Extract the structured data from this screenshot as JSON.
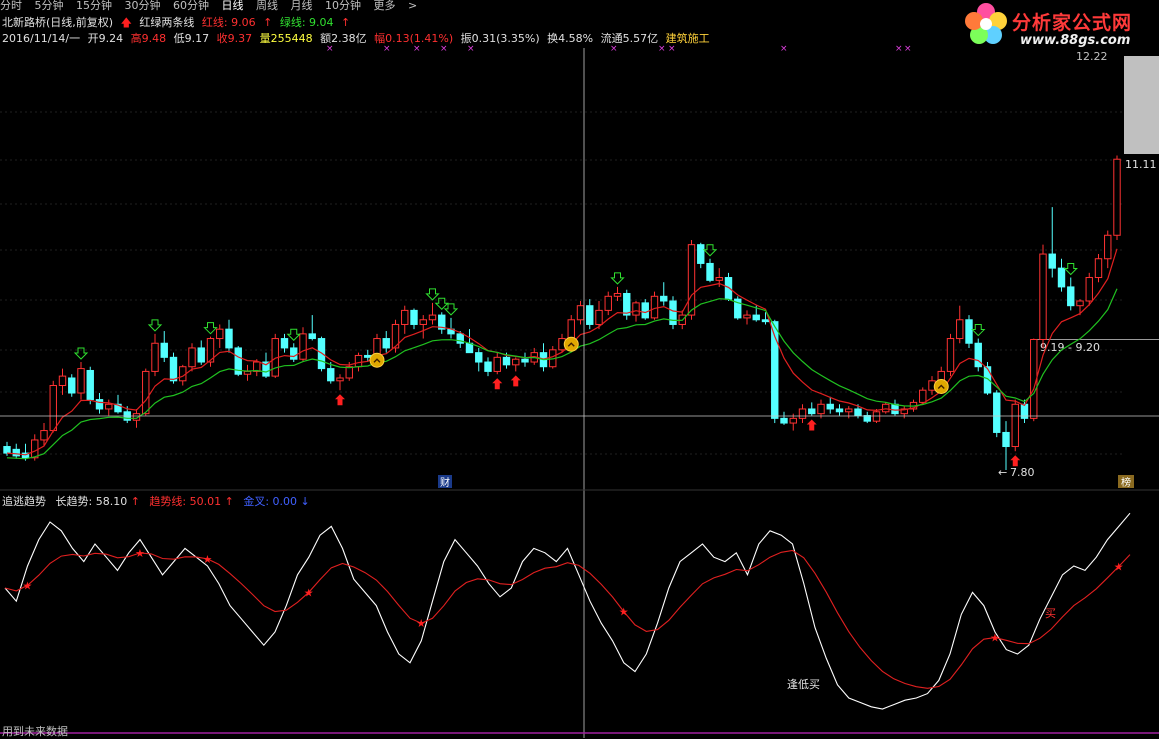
{
  "toolbar": {
    "items": [
      "分时",
      "5分钟",
      "15分钟",
      "30分钟",
      "60分钟",
      "日线",
      "周线",
      "月线",
      "10分钟",
      "更多",
      ">"
    ],
    "active": "日线"
  },
  "logo": {
    "title": "分析家公式网",
    "url": "www.88gs.com"
  },
  "header": {
    "stock": "北新路桥(日线,前复权)",
    "indicator": "红绿两条线",
    "red_label": "红线: 9.06",
    "green_label": "绿线: 9.04",
    "date": "2016/11/14/一",
    "open": "开9.24",
    "high": "高9.48",
    "low": "低9.17",
    "close": "收9.37",
    "volume": "量255448",
    "amount": "额2.38亿",
    "change": "幅0.13(1.41%)",
    "amplitude": "振0.31(3.35%)",
    "turnover": "换4.58%",
    "float": "流通5.57亿",
    "sector": "建筑施工"
  },
  "price_labels": {
    "top": "12.22",
    "high": "11.11",
    "range": "9.19 - 9.20",
    "low": "7.80"
  },
  "markers": {
    "cai": "财",
    "bang": "榜"
  },
  "lower": {
    "name": "追逃趋势",
    "long_trend": "长趋势: 58.10",
    "trend_line": "趋势线: 50.01",
    "golden": "金叉: 0.00",
    "low_buy_label": "逢低买",
    "buy_label": "买"
  },
  "footer": {
    "note": "用到未来数据"
  },
  "colors": {
    "up": "#ff3232",
    "down": "#54ffff",
    "red_ma": "#e02020",
    "green_ma": "#20c020",
    "cross": "#c8c8c8"
  },
  "chart_data": {
    "type": "candlestick",
    "candles": [
      [
        8.05,
        8.1,
        7.95,
        7.98
      ],
      [
        8.02,
        8.08,
        7.92,
        7.95
      ],
      [
        7.98,
        8.08,
        7.9,
        7.93
      ],
      [
        7.93,
        8.18,
        7.9,
        8.12
      ],
      [
        8.12,
        8.3,
        8.05,
        8.22
      ],
      [
        8.22,
        8.75,
        8.2,
        8.7
      ],
      [
        8.7,
        8.88,
        8.6,
        8.8
      ],
      [
        8.78,
        8.82,
        8.58,
        8.62
      ],
      [
        8.62,
        8.95,
        8.55,
        8.88
      ],
      [
        8.86,
        8.9,
        8.5,
        8.55
      ],
      [
        8.55,
        8.62,
        8.4,
        8.45
      ],
      [
        8.45,
        8.55,
        8.38,
        8.5
      ],
      [
        8.5,
        8.6,
        8.4,
        8.42
      ],
      [
        8.42,
        8.48,
        8.3,
        8.33
      ],
      [
        8.33,
        8.45,
        8.25,
        8.4
      ],
      [
        8.4,
        8.88,
        8.38,
        8.85
      ],
      [
        8.85,
        9.25,
        8.8,
        9.15
      ],
      [
        9.15,
        9.28,
        8.95,
        9.0
      ],
      [
        9.0,
        9.05,
        8.72,
        8.75
      ],
      [
        8.75,
        8.92,
        8.7,
        8.9
      ],
      [
        8.9,
        9.15,
        8.85,
        9.1
      ],
      [
        9.1,
        9.18,
        8.92,
        8.95
      ],
      [
        8.95,
        9.22,
        8.9,
        9.2
      ],
      [
        9.2,
        9.35,
        9.1,
        9.3
      ],
      [
        9.3,
        9.4,
        9.05,
        9.1
      ],
      [
        9.1,
        9.12,
        8.8,
        8.82
      ],
      [
        8.82,
        8.92,
        8.75,
        8.85
      ],
      [
        8.85,
        8.98,
        8.8,
        8.95
      ],
      [
        8.95,
        9.05,
        8.78,
        8.8
      ],
      [
        8.8,
        9.25,
        8.78,
        9.2
      ],
      [
        9.2,
        9.25,
        9.05,
        9.1
      ],
      [
        9.1,
        9.15,
        8.95,
        8.98
      ],
      [
        8.98,
        9.32,
        8.95,
        9.25
      ],
      [
        9.25,
        9.45,
        9.18,
        9.2
      ],
      [
        9.2,
        9.22,
        8.85,
        8.88
      ],
      [
        8.88,
        8.95,
        8.72,
        8.75
      ],
      [
        8.75,
        8.82,
        8.65,
        8.78
      ],
      [
        8.78,
        8.95,
        8.75,
        8.9
      ],
      [
        8.9,
        9.05,
        8.85,
        9.02
      ],
      [
        9.02,
        9.08,
        8.95,
        9.0
      ],
      [
        9.0,
        9.25,
        8.98,
        9.2
      ],
      [
        9.2,
        9.28,
        9.05,
        9.1
      ],
      [
        9.1,
        9.4,
        9.05,
        9.35
      ],
      [
        9.35,
        9.55,
        9.25,
        9.5
      ],
      [
        9.5,
        9.52,
        9.3,
        9.35
      ],
      [
        9.35,
        9.45,
        9.2,
        9.4
      ],
      [
        9.4,
        9.58,
        9.35,
        9.45
      ],
      [
        9.45,
        9.48,
        9.25,
        9.3
      ],
      [
        9.3,
        9.42,
        9.2,
        9.25
      ],
      [
        9.25,
        9.28,
        9.1,
        9.15
      ],
      [
        9.15,
        9.3,
        9.05,
        9.05
      ],
      [
        9.05,
        9.1,
        8.85,
        8.95
      ],
      [
        8.95,
        9.0,
        8.8,
        8.85
      ],
      [
        8.85,
        9.05,
        8.82,
        9.0
      ],
      [
        9.0,
        9.05,
        8.88,
        8.92
      ],
      [
        8.92,
        9.0,
        8.85,
        8.98
      ],
      [
        8.98,
        9.05,
        8.9,
        8.95
      ],
      [
        8.95,
        9.1,
        8.92,
        9.05
      ],
      [
        9.05,
        9.15,
        8.85,
        8.9
      ],
      [
        8.9,
        9.12,
        8.88,
        9.08
      ],
      [
        9.08,
        9.25,
        9.05,
        9.2
      ],
      [
        9.2,
        9.45,
        9.15,
        9.4
      ],
      [
        9.4,
        9.6,
        9.35,
        9.55
      ],
      [
        9.55,
        9.62,
        9.3,
        9.35
      ],
      [
        9.35,
        9.6,
        9.3,
        9.5
      ],
      [
        9.5,
        9.7,
        9.45,
        9.65
      ],
      [
        9.65,
        9.75,
        9.6,
        9.68
      ],
      [
        9.68,
        9.72,
        9.4,
        9.45
      ],
      [
        9.45,
        9.6,
        9.38,
        9.58
      ],
      [
        9.58,
        9.62,
        9.4,
        9.42
      ],
      [
        9.42,
        9.7,
        9.4,
        9.65
      ],
      [
        9.65,
        9.8,
        9.55,
        9.6
      ],
      [
        9.6,
        9.65,
        9.3,
        9.35
      ],
      [
        9.35,
        9.5,
        9.3,
        9.45
      ],
      [
        9.45,
        10.25,
        9.4,
        10.2
      ],
      [
        10.2,
        10.22,
        9.95,
        10.0
      ],
      [
        10.0,
        10.05,
        9.8,
        9.82
      ],
      [
        9.82,
        9.95,
        9.75,
        9.85
      ],
      [
        9.85,
        9.9,
        9.6,
        9.62
      ],
      [
        9.62,
        9.65,
        9.4,
        9.42
      ],
      [
        9.42,
        9.5,
        9.35,
        9.45
      ],
      [
        9.45,
        9.55,
        9.38,
        9.4
      ],
      [
        9.4,
        9.48,
        9.35,
        9.38
      ],
      [
        9.38,
        9.4,
        8.3,
        8.35
      ],
      [
        8.35,
        8.42,
        8.28,
        8.3
      ],
      [
        8.3,
        8.4,
        8.22,
        8.35
      ],
      [
        8.35,
        8.5,
        8.3,
        8.45
      ],
      [
        8.45,
        8.52,
        8.38,
        8.4
      ],
      [
        8.4,
        8.55,
        8.35,
        8.5
      ],
      [
        8.5,
        8.58,
        8.4,
        8.45
      ],
      [
        8.45,
        8.5,
        8.38,
        8.42
      ],
      [
        8.42,
        8.48,
        8.35,
        8.45
      ],
      [
        8.45,
        8.5,
        8.35,
        8.38
      ],
      [
        8.38,
        8.42,
        8.3,
        8.32
      ],
      [
        8.32,
        8.45,
        8.3,
        8.42
      ],
      [
        8.42,
        8.52,
        8.4,
        8.5
      ],
      [
        8.5,
        8.55,
        8.38,
        8.4
      ],
      [
        8.4,
        8.48,
        8.35,
        8.45
      ],
      [
        8.45,
        8.55,
        8.42,
        8.52
      ],
      [
        8.52,
        8.68,
        8.5,
        8.65
      ],
      [
        8.65,
        8.8,
        8.6,
        8.75
      ],
      [
        8.75,
        8.9,
        8.7,
        8.85
      ],
      [
        8.85,
        9.25,
        8.8,
        9.2
      ],
      [
        9.2,
        9.55,
        9.15,
        9.4
      ],
      [
        9.4,
        9.45,
        9.1,
        9.15
      ],
      [
        9.15,
        9.2,
        8.85,
        8.9
      ],
      [
        8.9,
        8.95,
        8.6,
        8.62
      ],
      [
        8.62,
        8.65,
        8.15,
        8.2
      ],
      [
        8.2,
        8.32,
        7.8,
        8.05
      ],
      [
        8.05,
        8.55,
        8.0,
        8.5
      ],
      [
        8.5,
        8.55,
        8.3,
        8.35
      ],
      [
        8.35,
        9.2,
        8.32,
        9.19
      ],
      [
        9.19,
        10.2,
        9.1,
        10.1
      ],
      [
        10.1,
        10.6,
        9.85,
        9.95
      ],
      [
        9.95,
        10.05,
        9.7,
        9.75
      ],
      [
        9.75,
        9.85,
        9.5,
        9.55
      ],
      [
        9.55,
        9.62,
        9.45,
        9.6
      ],
      [
        9.6,
        9.9,
        9.55,
        9.85
      ],
      [
        9.85,
        10.1,
        9.8,
        10.05
      ],
      [
        10.05,
        10.35,
        9.95,
        10.3
      ],
      [
        10.3,
        11.15,
        10.25,
        11.11
      ]
    ],
    "trend_white": [
      60,
      54,
      70,
      82,
      90,
      86,
      78,
      72,
      80,
      74,
      68,
      76,
      82,
      74,
      66,
      72,
      78,
      74,
      70,
      62,
      52,
      46,
      40,
      34,
      40,
      52,
      66,
      74,
      84,
      88,
      78,
      64,
      58,
      52,
      40,
      30,
      26,
      36,
      54,
      72,
      82,
      76,
      70,
      62,
      56,
      60,
      72,
      78,
      76,
      72,
      78,
      66,
      54,
      44,
      36,
      26,
      22,
      30,
      44,
      60,
      72,
      76,
      80,
      74,
      72,
      76,
      66,
      80,
      86,
      84,
      80,
      62,
      42,
      28,
      16,
      10,
      8,
      6,
      5,
      7,
      9,
      10,
      12,
      18,
      30,
      48,
      58,
      52,
      40,
      32,
      30,
      34,
      46,
      56,
      66,
      70,
      68,
      74,
      82,
      88,
      94
    ]
  }
}
